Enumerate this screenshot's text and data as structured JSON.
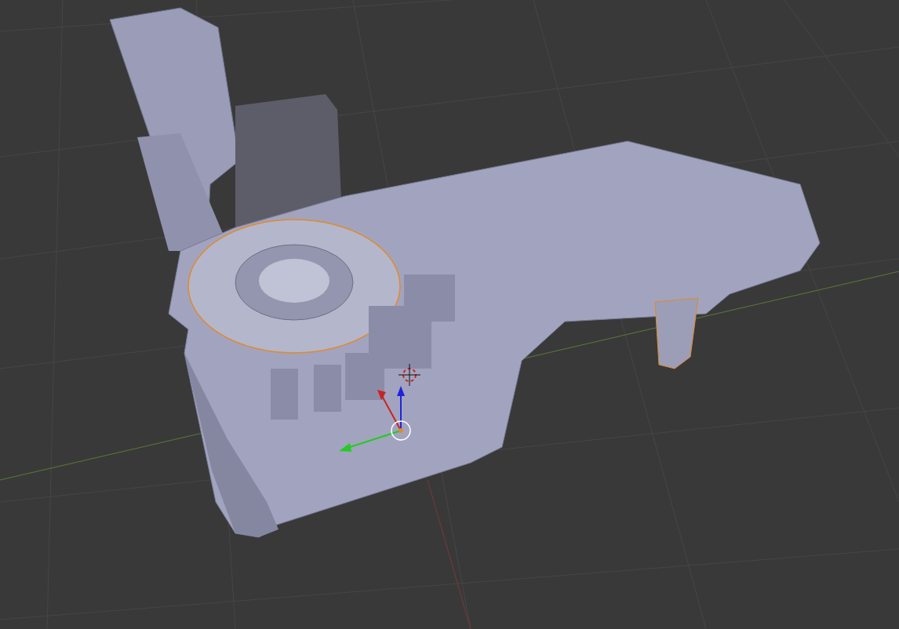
{
  "viewport": {
    "show_grid": true,
    "show_axes": true,
    "show_manipulator": true,
    "show_3d_cursor": true
  }
}
